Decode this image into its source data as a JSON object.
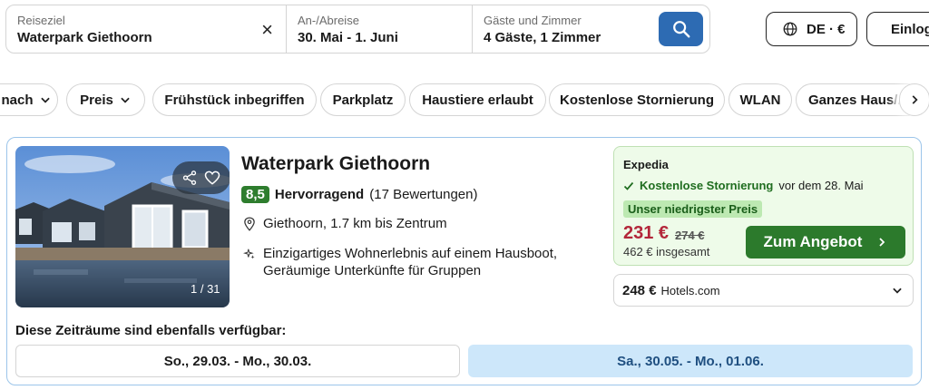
{
  "search": {
    "destination_label": "Reiseziel",
    "destination_value": "Waterpark Giethoorn",
    "dates_label": "An-/Abreise",
    "dates_value": "30. Mai - 1. Juni",
    "guests_label": "Gäste und Zimmer",
    "guests_value": "4 Gäste, 1 Zimmer",
    "clear_icon": "×"
  },
  "header": {
    "locale_label": "DE · €",
    "login_label": "Einloggen"
  },
  "filters": [
    "nach",
    "Preis",
    "Frühstück inbegriffen",
    "Parkplatz",
    "Haustiere erlaubt",
    "Kostenlose Stornierung",
    "WLAN",
    "Ganzes Haus/Apartment"
  ],
  "result": {
    "name": "Waterpark Giethoorn",
    "photo_count": "1 / 31",
    "score": "8,5",
    "rating_label": "Hervorragend",
    "reviews": "(17 Bewertungen)",
    "location": "Giethoorn, 1.7 km bis Zentrum",
    "features_line1": "Einzigartiges Wohnerlebnis auf einem Hausboot,",
    "features_line2": "Geräumige Unterkünfte für Gruppen",
    "offer": {
      "provider": "Expedia",
      "cancel_highlight": "Kostenlose Stornierung",
      "cancel_rest": "vor dem 28. Mai",
      "badge": "Unser niedrigster Preis",
      "price": "231 €",
      "old_price": "274 €",
      "total": "462 € insgesamt",
      "button": "Zum Angebot"
    },
    "alt_offer": {
      "price": "248 €",
      "provider": "Hotels.com"
    },
    "availability_label": "Diese Zeiträume sind ebenfalls verfügbar:",
    "date_options": [
      "So., 29.03. - Mo., 30.03.",
      "Sa., 30.05. - Mo., 01.06."
    ]
  },
  "colors": {
    "accent_blue": "#2d6bb3",
    "deal_green": "#2c7a2c",
    "price_red": "#b3263a",
    "selected_date_bg": "#cde7fa"
  },
  "icons": [
    "close-icon",
    "search-icon",
    "globe-icon",
    "user-icon",
    "chevron-down-icon",
    "chevron-right-icon",
    "share-icon",
    "heart-icon",
    "location-pin-icon",
    "sparkle-icon",
    "checkmark-icon"
  ]
}
